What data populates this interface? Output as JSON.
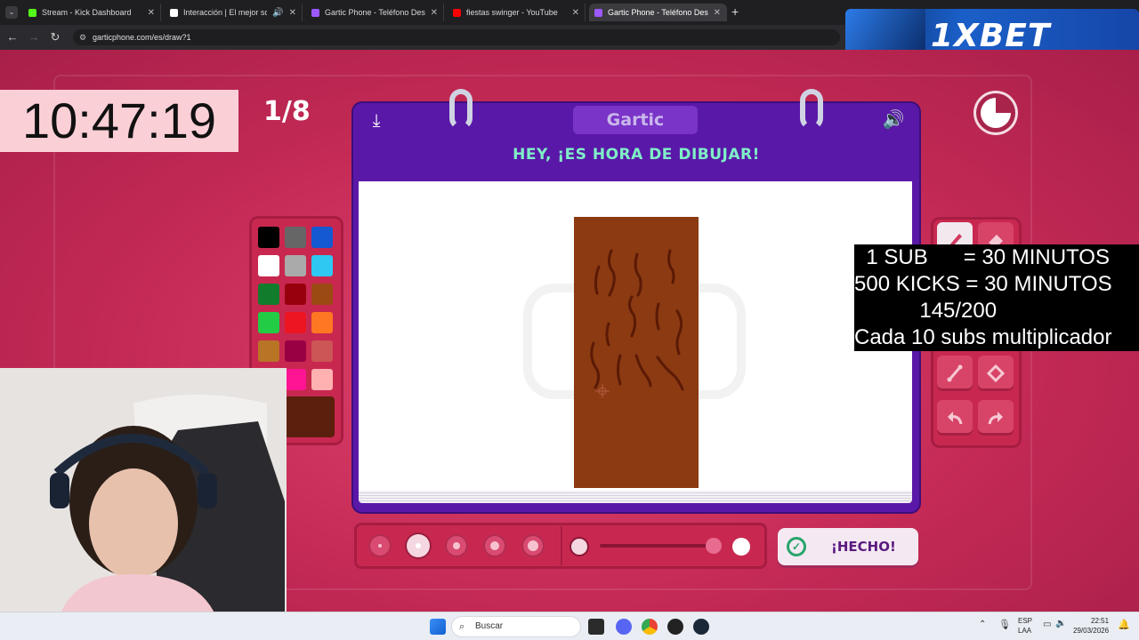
{
  "browser": {
    "tabs": [
      {
        "title": "Stream - Kick Dashboard",
        "favicon_color": "#53fc18",
        "active": false
      },
      {
        "title": "Interacción | El mejor softw",
        "favicon_color": "#ffffff",
        "active": false
      },
      {
        "title": "Gartic Phone - Teléfono Descon",
        "favicon_color": "#9b59ff",
        "active": false
      },
      {
        "title": "fiestas swinger - YouTube",
        "favicon_color": "#ff0000",
        "active": false
      },
      {
        "title": "Gartic Phone - Teléfono Descon",
        "favicon_color": "#9b59ff",
        "active": true
      }
    ],
    "new_tab": "+",
    "url": "garticphone.com/es/draw?1"
  },
  "ad": {
    "brand": "1XBET"
  },
  "overlay": {
    "clock": "10:47:19",
    "sub_lines": [
      "  1 SUB      = 30 MINUTOS",
      "500 KICKS = 30 MINUTOS",
      "           145/200",
      "Cada 10 subs multiplicador"
    ]
  },
  "game": {
    "round": "1/8",
    "brand": "Gartic",
    "prompt": "HEY, ¡ES HORA DE DIBUJAR!",
    "done_label": "¡HECHO!",
    "palette": [
      "#000000",
      "#666666",
      "#1459d2",
      "#ffffff",
      "#aaaaaa",
      "#2ec8f2",
      "#117c2c",
      "#99000e",
      "#9b4a13",
      "#22cc44",
      "#ee1522",
      "#ff7722",
      "#b87526",
      "#990044",
      "#cc5555",
      "#aa3322",
      "#ff1493",
      "#ffb0b0"
    ],
    "current_color": "#5b1f0d",
    "drawing_color": "#8b3a12",
    "stroke_color": "#5a1a05",
    "brush_sizes": [
      1,
      2,
      3,
      4,
      5
    ],
    "selected_brush": 2,
    "opacity_percent": 100
  },
  "taskbar": {
    "search_placeholder": "Buscar",
    "lang": "ESP",
    "lang_sub": "LAA",
    "time": "22:51",
    "date": "29/03/2026"
  }
}
